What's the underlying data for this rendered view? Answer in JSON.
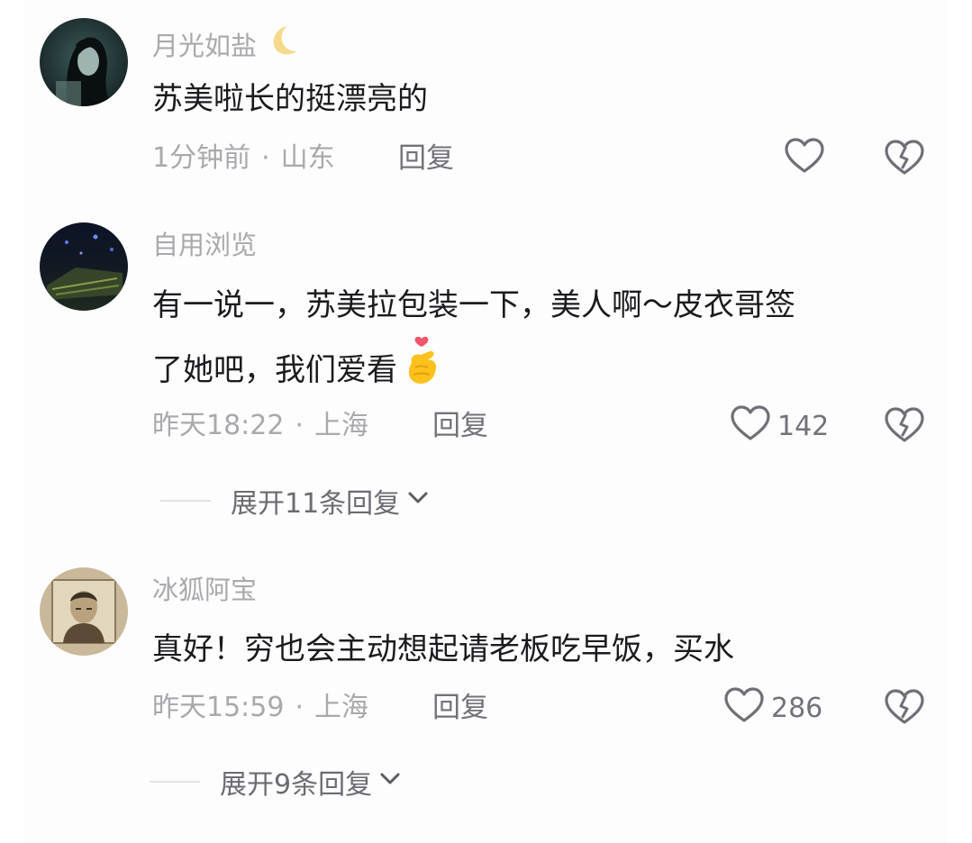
{
  "comments": [
    {
      "username": "月光如盐",
      "username_emoji": "crescent-moon",
      "text": "苏美啦长的挺漂亮的",
      "time": "1分钟前",
      "location": "山东",
      "reply_label": "回复",
      "like_count": ""
    },
    {
      "username": "自用浏览",
      "text_line1": "有一说一，苏美拉包装一下，美人啊～皮衣哥签",
      "text_line2": "了她吧，我们爱看",
      "text_emoji": "finger-heart",
      "time": "昨天18:22",
      "location": "上海",
      "reply_label": "回复",
      "like_count": "142",
      "expand_label": "展开11条回复"
    },
    {
      "username": "冰狐阿宝",
      "text": "真好！穷也会主动想起请老板吃早饭，买水",
      "time": "昨天15:59",
      "location": "上海",
      "reply_label": "回复",
      "like_count": "286",
      "expand_label": "展开9条回复"
    }
  ],
  "separator": "·",
  "icons": {
    "like": "heart-outline-icon",
    "dislike": "broken-heart-icon",
    "expand": "chevron-down-icon"
  },
  "colors": {
    "username": "#a9a9ad",
    "content": "#1b1b1f",
    "meta": "#a9a9ad",
    "action": "#72727a"
  }
}
